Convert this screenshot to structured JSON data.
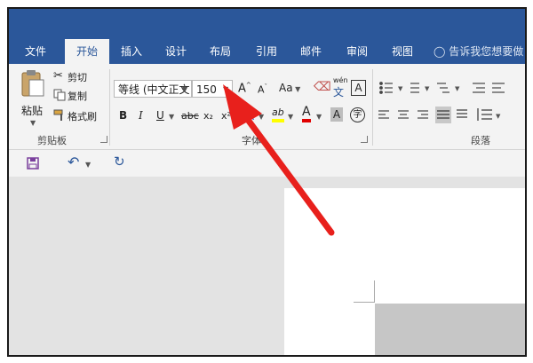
{
  "tabs": [
    "文件",
    "开始",
    "插入",
    "设计",
    "布局",
    "引用",
    "邮件",
    "审阅",
    "视图"
  ],
  "tell_me": "告诉我您想要做",
  "clipboard": {
    "paste": "粘贴",
    "cut": "剪切",
    "copy": "复制",
    "format_painter": "格式刷",
    "group_label": "剪贴板"
  },
  "font": {
    "font_name": "等线 (中文正文",
    "font_size": "150",
    "grow_label": "A",
    "shrink_label": "A",
    "case_label": "Aa",
    "phonetic_top": "wén",
    "phonetic_bottom": "文",
    "border_char": "A",
    "bold": "B",
    "italic": "I",
    "underline": "U",
    "strike": "abc",
    "subscript": "x₂",
    "superscript": "x²",
    "effects": "A",
    "highlight": "ab",
    "font_color": "A",
    "shading": "A",
    "enclose": "字",
    "group_label": "字体"
  },
  "paragraph": {
    "group_label": "段落"
  },
  "colors": {
    "ribbon_blue": "#2b579a",
    "arrow_red": "#e8201c"
  }
}
